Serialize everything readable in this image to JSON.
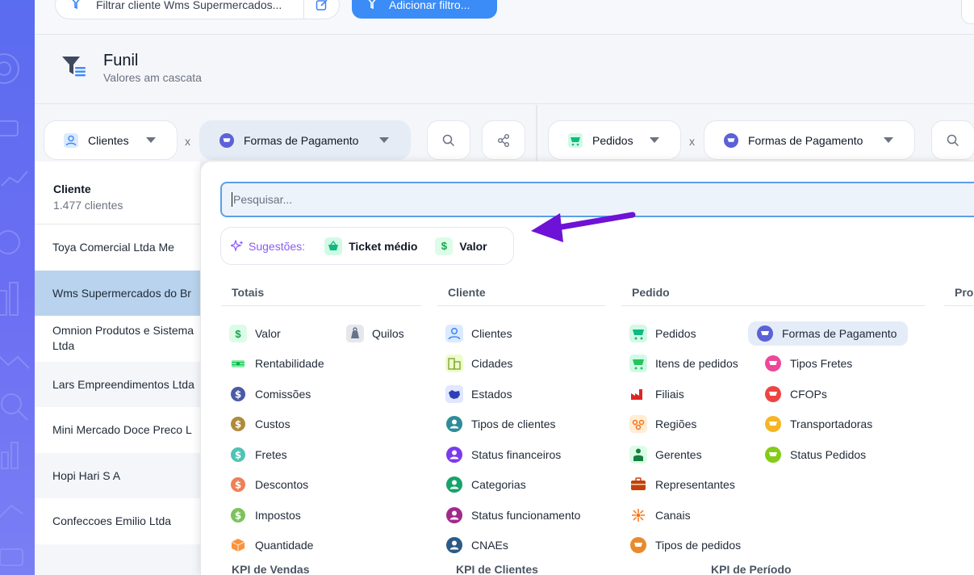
{
  "topbar": {
    "filter_label": "Filtrar cliente Wms Supermercados...",
    "add_filter_label": "Adicionar filtro..."
  },
  "header": {
    "title": "Funil",
    "subtitle": "Valores am cascata"
  },
  "selectors": {
    "left_a": "Clientes",
    "left_b": "Formas de Pagamento",
    "right_a": "Pedidos",
    "right_b": "Formas de Pagamento",
    "sep": "x"
  },
  "table": {
    "header": "Cliente",
    "count": "1.477 clientes",
    "rows": [
      "Toya Comercial Ltda Me",
      "Wms Supermercados do Br",
      "Omnion Produtos e Sistema Ltda",
      "Lars Empreendimentos Ltda",
      "Mini Mercado Doce Preco L",
      "Hopi Hari S A",
      "Confeccoes Emilio Ltda"
    ]
  },
  "dropdown": {
    "search_placeholder": "Pesquisar...",
    "suggestions_label": "Sugestões:",
    "suggestions": [
      "Ticket médio",
      "Valor"
    ],
    "columns": {
      "totais": {
        "header": "Totais",
        "items": [
          "Valor",
          "Quilos",
          "Rentabilidade",
          "Comissões",
          "Custos",
          "Fretes",
          "Descontos",
          "Impostos",
          "Quantidade"
        ]
      },
      "cliente": {
        "header": "Cliente",
        "items": [
          "Clientes",
          "Cidades",
          "Estados",
          "Tipos de clientes",
          "Status financeiros",
          "Categorias",
          "Status funcionamento",
          "CNAEs"
        ]
      },
      "pedido": {
        "header": "Pedido",
        "items": [
          "Pedidos",
          "Itens de pedidos",
          "Filiais",
          "Regiões",
          "Gerentes",
          "Representantes",
          "Canais",
          "Tipos de pedidos",
          "Formas de Pagamento",
          "Tipos Fretes",
          "CFOPs",
          "Transportadoras",
          "Status Pedidos"
        ]
      },
      "produto": {
        "header": "Pro"
      }
    },
    "kpi_headers": [
      "KPI de Vendas",
      "KPI de Clientes",
      "KPI de Período"
    ]
  },
  "colors": {
    "accent": "#3b8cf6",
    "selected_row": "#b9d3ee",
    "arrow": "#6d12d6"
  }
}
